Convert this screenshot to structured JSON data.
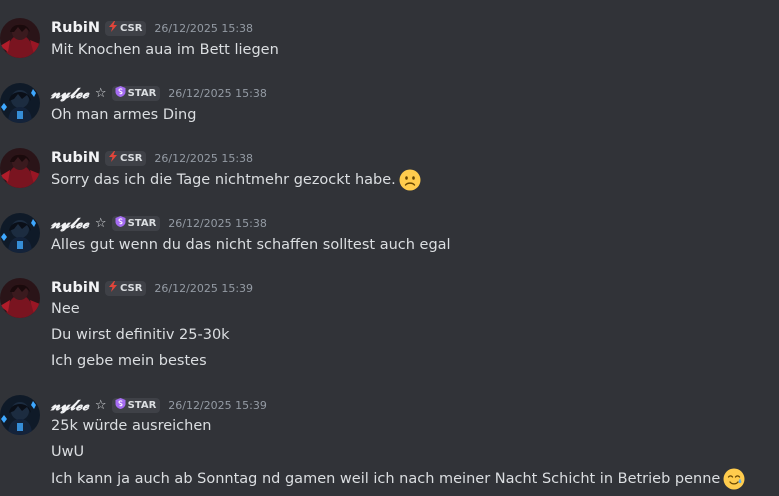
{
  "messages": [
    {
      "author": "RubiN",
      "tag": "CSR",
      "timestamp": "26/12/2025 15:38",
      "lines": [
        "Mit Knochen aua im Bett liegen"
      ]
    },
    {
      "author": "𝓷𝔂𝓵𝓮𝓮",
      "star": "☆",
      "tag": "STAR",
      "timestamp": "26/12/2025 15:38",
      "lines": [
        "Oh man armes Ding"
      ]
    },
    {
      "author": "RubiN",
      "tag": "CSR",
      "timestamp": "26/12/2025 15:38",
      "lines": [
        "Sorry das ich die Tage nichtmehr gezockt habe."
      ]
    },
    {
      "author": "𝓷𝔂𝓵𝓮𝓮",
      "star": "☆",
      "tag": "STAR",
      "timestamp": "26/12/2025 15:38",
      "lines": [
        "Alles gut wenn du das nicht schaffen solltest auch egal"
      ]
    },
    {
      "author": "RubiN",
      "tag": "CSR",
      "timestamp": "26/12/2025 15:39",
      "lines": [
        "Nee",
        "Du wirst definitiv 25-30k",
        "Ich gebe mein bestes"
      ]
    },
    {
      "author": "𝓷𝔂𝓵𝓮𝓮",
      "star": "☆",
      "tag": "STAR",
      "timestamp": "26/12/2025 15:39",
      "lines": [
        "25k würde ausreichen",
        "UwU",
        "Ich kann ja auch ab Sonntag nd gamen weil ich nach meiner Nacht Schicht in Betrieb penne"
      ]
    }
  ],
  "icons": {
    "csr_tag_icon": "lightning-bolt-icon",
    "star_tag_icon": "shield-s-icon",
    "emoji_sad": "slightly-frowning-face-emoji",
    "emoji_tear": "smiling-face-with-tear-emoji"
  },
  "colors": {
    "background": "#313338",
    "text": "#dbdee1",
    "username": "#f2f3f5",
    "timestamp": "#949ba4",
    "tag_bg": "#3f4147",
    "csr_icon": "#e0453a",
    "star_icon": "#a56cf2"
  }
}
